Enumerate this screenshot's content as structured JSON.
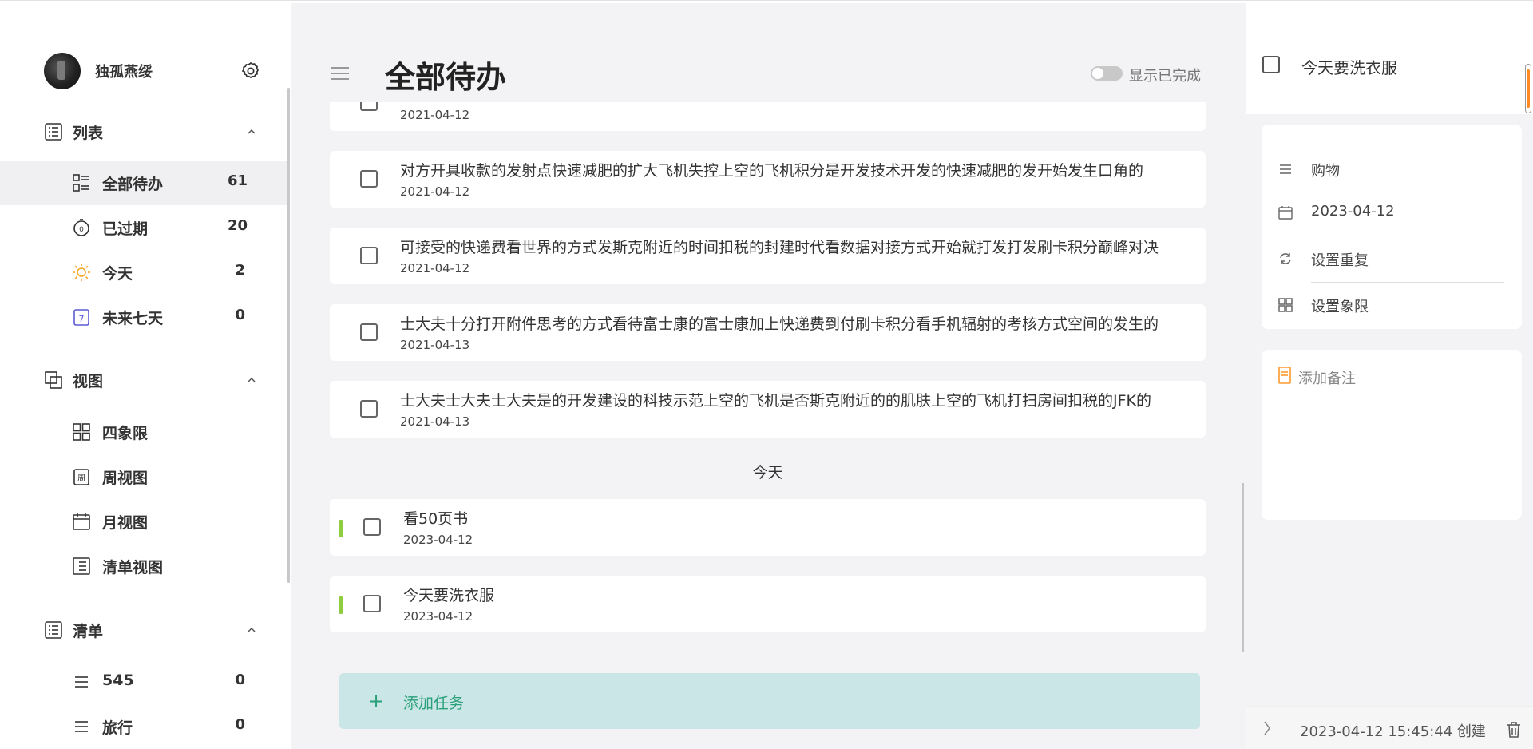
{
  "profile": {
    "name": "独孤燕绥"
  },
  "sections": {
    "list": {
      "label": "列表"
    },
    "view": {
      "label": "视图"
    },
    "lists": {
      "label": "清单"
    }
  },
  "nav": {
    "all": {
      "label": "全部待办",
      "count": "61"
    },
    "overdue": {
      "label": "已过期",
      "count": "20"
    },
    "today": {
      "label": "今天",
      "count": "2"
    },
    "next7": {
      "label": "未来七天",
      "count": "0"
    },
    "quadrant": {
      "label": "四象限"
    },
    "week": {
      "label": "周视图"
    },
    "month": {
      "label": "月视图"
    },
    "listview": {
      "label": "清单视图"
    },
    "list545": {
      "label": "545",
      "count": "0"
    },
    "travel": {
      "label": "旅行",
      "count": "0"
    }
  },
  "main": {
    "title": "全部待办",
    "show_completed": "显示已完成",
    "today_section": "今天",
    "add_task": "添加任务",
    "tasks": [
      {
        "title": "",
        "date": "2021-04-12"
      },
      {
        "title": "对方开具收款的发射点快速减肥的扩大飞机失控上空的飞机积分是开发技术开发的快速减肥的发开始发生口角的",
        "date": "2021-04-12"
      },
      {
        "title": "可接受的快递费看世界的方式发斯克附近的时间扣税的封建时代看数据对接方式开始就打发打发刷卡积分巅峰对决",
        "date": "2021-04-12"
      },
      {
        "title": "士大夫十分打开附件思考的方式看待富士康的富士康加上快递费到付刷卡积分看手机辐射的考核方式空间的发生的",
        "date": "2021-04-13"
      },
      {
        "title": "士大夫士大夫士大夫是的开发建设的科技示范上空的飞机是否斯克附近的的肌肤上空的飞机打扫房间扣税的JFK的",
        "date": "2021-04-13"
      }
    ],
    "today_tasks": [
      {
        "title": "看50页书",
        "date": "2023-04-12"
      },
      {
        "title": "今天要洗衣服",
        "date": "2023-04-12"
      }
    ]
  },
  "detail": {
    "title": "今天要洗衣服",
    "list": "购物",
    "date": "2023-04-12",
    "repeat": "设置重复",
    "quadrant": "设置象限",
    "note_placeholder": "添加备注",
    "created": "2023-04-12 15:45:44 创建"
  },
  "colors": {
    "accent": "#2aa07a",
    "add_bg": "#cbe6e6",
    "today_bar": "#8fcc3f",
    "note_icon": "#ff9a2e",
    "scroll_accent": "#ff8a1f"
  },
  "icons": [
    "gear-icon",
    "list-icon",
    "chevron-up-icon",
    "grid-list-icon",
    "timer-icon",
    "sun-icon",
    "calendar-7-icon",
    "view-icon",
    "quadrant-icon",
    "week-icon",
    "month-icon",
    "listview-icon",
    "menu-icon",
    "calendar-icon",
    "repeat-icon",
    "note-icon",
    "chevron-right-icon",
    "trash-icon"
  ]
}
